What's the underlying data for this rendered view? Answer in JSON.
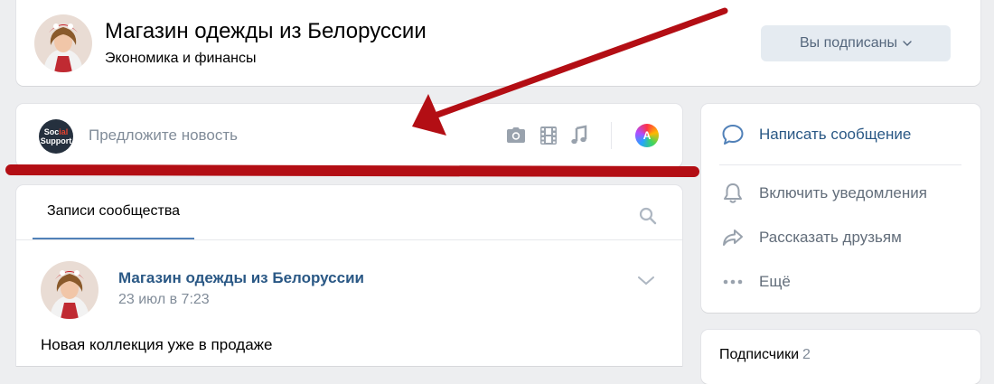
{
  "header": {
    "title": "Магазин одежды из Белоруссии",
    "category": "Экономика и финансы",
    "subscribe_label": "Вы подписаны"
  },
  "suggest": {
    "logo_top": "Soc",
    "logo_accent": "ial",
    "logo_bottom": "Support",
    "placeholder": "Предложите новость",
    "poster_letter": "A",
    "icons": [
      "camera-icon",
      "video-icon",
      "music-icon",
      "poster-icon"
    ]
  },
  "posts": {
    "tab_label": "Записи сообщества",
    "post": {
      "author": "Магазин одежды из Белоруссии",
      "date": "23 июл в 7:23",
      "text": "Новая коллекция уже в продаже"
    }
  },
  "actions": {
    "items": [
      {
        "label": "Написать сообщение",
        "icon": "message-icon"
      },
      {
        "label": "Включить уведомления",
        "icon": "bell-icon"
      },
      {
        "label": "Рассказать друзьям",
        "icon": "share-icon"
      },
      {
        "label": "Ещё",
        "icon": "more-icon"
      }
    ]
  },
  "subscribers": {
    "label": "Подписчики",
    "count": "2"
  },
  "colors": {
    "link": "#2a5885",
    "muted": "#818c99",
    "accent": "#5181b8",
    "annotation": "#b30e14",
    "background": "#edeef0"
  }
}
